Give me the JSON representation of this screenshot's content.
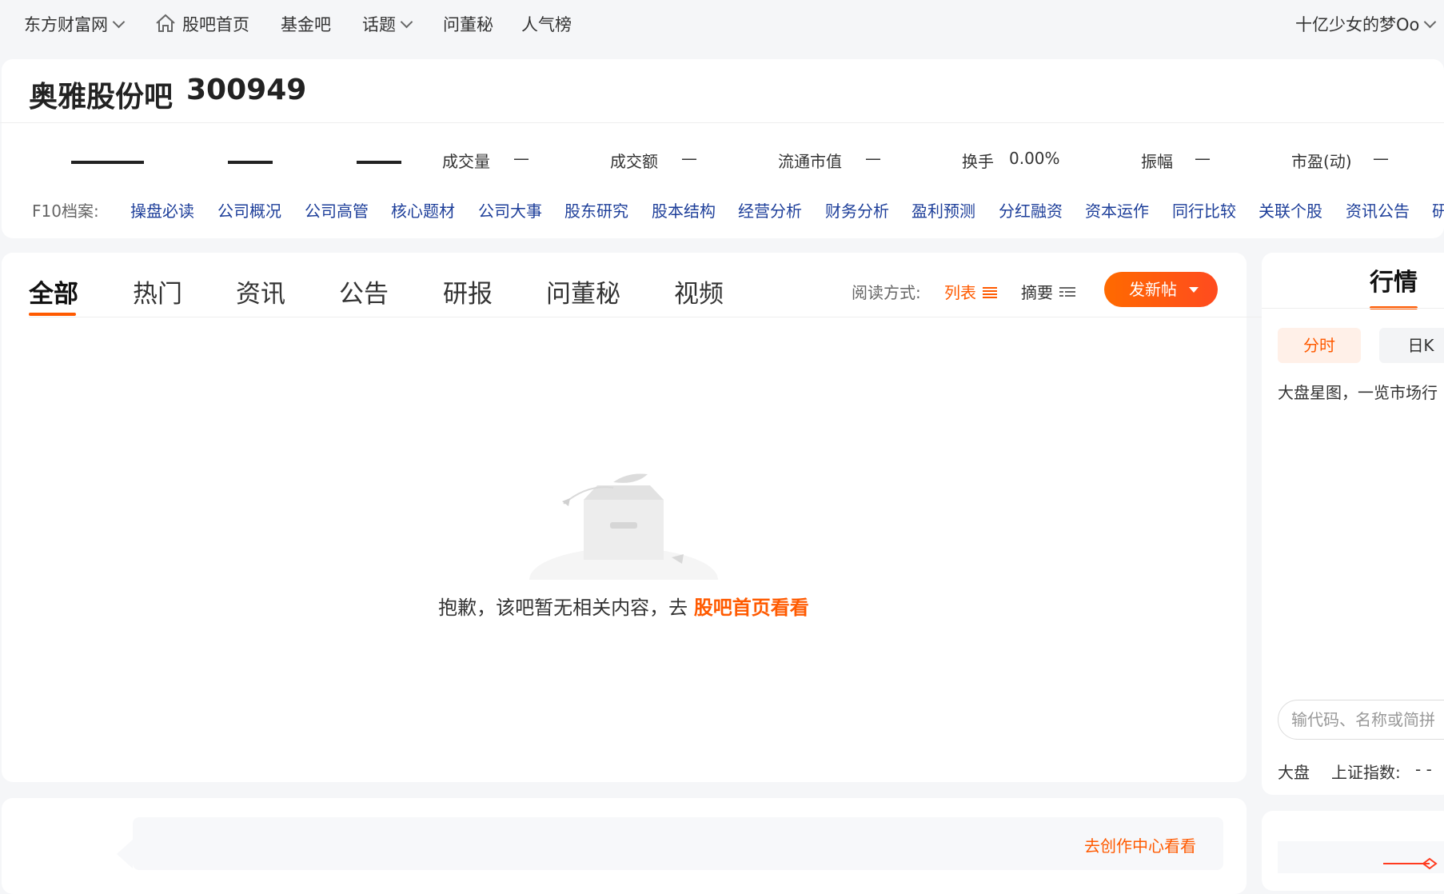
{
  "topnav": {
    "site": "东方财富网",
    "home": "股吧首页",
    "fund": "基金吧",
    "topics": "话题",
    "secretary": "问董秘",
    "popularity": "人气榜",
    "user": "十亿少女的梦Oo"
  },
  "stock": {
    "name": "奥雅股份吧",
    "code": "300949"
  },
  "quote": {
    "volume_label": "成交量",
    "volume_value": "—",
    "amount_label": "成交额",
    "amount_value": "—",
    "mktcap_label": "流通市值",
    "mktcap_value": "—",
    "turnover_label": "换手",
    "turnover_value": "0.00%",
    "amplitude_label": "振幅",
    "amplitude_value": "—",
    "pe_label": "市盈(动)",
    "pe_value": "—"
  },
  "f10": {
    "label": "F10档案:",
    "links": [
      "操盘必读",
      "公司概况",
      "公司高管",
      "核心题材",
      "公司大事",
      "股东研究",
      "股本结构",
      "经营分析",
      "财务分析",
      "盈利预测",
      "分红融资",
      "资本运作",
      "同行比较",
      "关联个股",
      "资讯公告",
      "研"
    ]
  },
  "tabs": [
    "全部",
    "热门",
    "资讯",
    "公告",
    "研报",
    "问董秘",
    "视频"
  ],
  "reading": {
    "label": "阅读方式:",
    "list": "列表",
    "summary": "摘要"
  },
  "post_button": "发新帖",
  "empty": {
    "text": "抱歉，该吧暂无相关内容，去 ",
    "link": "股吧首页看看"
  },
  "creator": {
    "link": "去创作中心看看"
  },
  "sidebar": {
    "title": "行情",
    "tab_fenshi": "分时",
    "tab_rik": "日K",
    "desc": "大盘星图，一览市场行",
    "search_placeholder": "输代码、名称或简拼",
    "market_label": "大盘",
    "index_label": "上证指数:",
    "index_value": "- -"
  },
  "colors": {
    "accent": "#ff5a00",
    "link": "#1e3f9a",
    "background": "#f5f6f8"
  }
}
